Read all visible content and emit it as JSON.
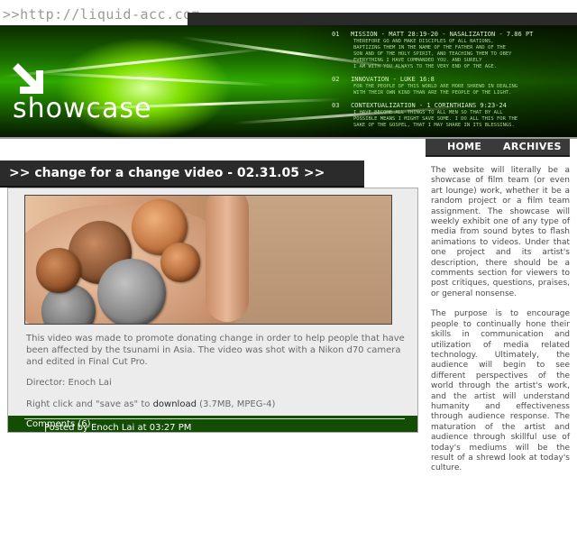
{
  "site": {
    "url_prefix": ">>",
    "url_text": "http://liquid-acc.com"
  },
  "banner": {
    "logo_text": "showcase",
    "verses": [
      {
        "number": "01",
        "title": "MISSION - MATT 28:19-20 - NASALIZATION - 7.86 PT",
        "body": "THEREFORE GO AND MAKE DISCIPLES OF ALL NATIONS,\nBAPTIZING THEM IN THE NAME OF THE FATHER AND OF THE\nSON AND OF THE HOLY SPIRIT, AND TEACHING THEM TO OBEY\nEVERYTHING I HAVE COMMANDED YOU. AND SURELY\nI AM WITH YOU ALWAYS TO THE VERY END OF THE AGE."
      },
      {
        "number": "02",
        "title": "INNOVATION - LUKE 16:8",
        "body": "FOR THE PEOPLE OF THIS WORLD ARE MORE SHREWD IN DEALING\nWITH THEIR OWN KIND THAN ARE THE PEOPLE OF THE LIGHT."
      },
      {
        "number": "03",
        "title": "CONTEXTUALIZATION - 1 CORINTHIANS 9:23-24",
        "body": "I HAVE BECOME ALL THINGS TO ALL MEN SO THAT BY ALL\nPOSSIBLE MEANS I MIGHT SAVE SOME. I DO ALL THIS FOR THE\nSAKE OF THE GOSPEL, THAT I MAY SHARE IN ITS BLESSINGS."
      }
    ]
  },
  "nav": {
    "home": "HOME",
    "archives": "ARCHIVES"
  },
  "post": {
    "title": ">> change for a change video - 02.31.05 >>",
    "paragraph": "This video was made to promote donating change in order to help people that have been affected by the tsunami in Asia. The video was shot with a Nikon d70 camera and edited in Final Cut Pro.",
    "director": "Director: Enoch Lai",
    "download_prefix": "Right click and \"save as\" to",
    "download_link": "download",
    "download_suffix": "(3.7MB, MPEG-4)",
    "footer": {
      "posted_by": "Posted by Enoch Lai at 03:27 PM",
      "separator": "|",
      "comments": "Comments (6)"
    }
  },
  "sidebar": {
    "paragraph1": "The website will literally be a showcase of film team (or even art lounge) work, whether it be a random project or a film team assignment. The showcase will weekly exhibit one of any type of media from sound bytes to flash animations to videos. Under that one project and its artist's description, there should be a comments section for viewers to post critiques, questions, praises, or general nonsense.",
    "paragraph2": "The purpose is to encourage people to continually hone their skills in communication and utilization of media related technology. Ultimately, the audience will begin to see different perspectives of the world through the artist's work, and the artist will understand humanity and effectiveness through audience response. The maturation of the artist and audience through skillful use of today's mediums will be the result of a shrewd look at today's culture."
  },
  "colors": {
    "banner_green": "#2eaa00",
    "footer_green": "#124d03",
    "title_bar": "#2b2b2b"
  }
}
